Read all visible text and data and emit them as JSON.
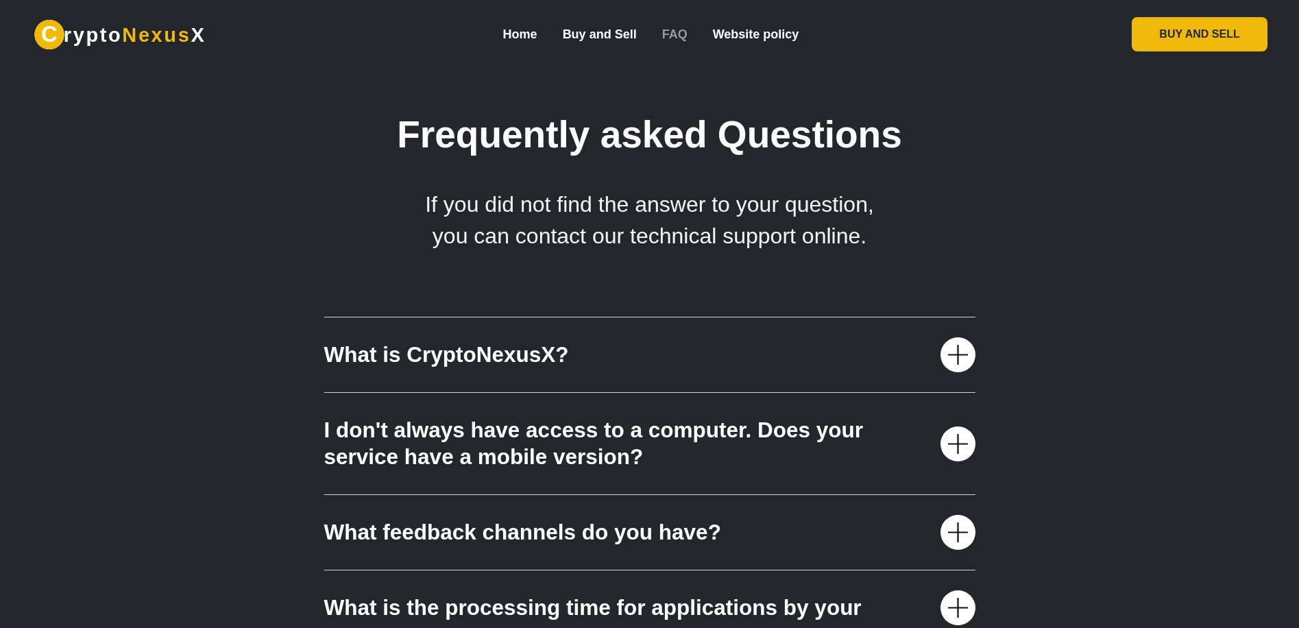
{
  "header": {
    "logo": {
      "badge_letter": "C",
      "segments": [
        {
          "text": "rypto",
          "color": "#ffffff"
        },
        {
          "text": "Nexus",
          "color": "#f0b90b"
        },
        {
          "text": "X",
          "color": "#ffffff"
        }
      ]
    },
    "nav": [
      {
        "label": "Home",
        "selected": false
      },
      {
        "label": "Buy and Sell",
        "selected": false
      },
      {
        "label": "FAQ",
        "selected": true
      },
      {
        "label": "Website policy",
        "selected": false
      }
    ],
    "cta_button": "BUY AND SELL"
  },
  "hero": {
    "title": "Frequently asked Questions",
    "subtitle": "If you did not find the answer to your question,\nyou can contact our technical support online."
  },
  "faq": [
    {
      "question": "What is CryptoNexusX?",
      "expanded": false
    },
    {
      "question": "I don't always have access to a computer. Does your service have a mobile version?",
      "expanded": false
    },
    {
      "question": "What feedback channels do you have?",
      "expanded": false
    },
    {
      "question": "What is the processing time for applications by your",
      "expanded": false
    }
  ]
}
